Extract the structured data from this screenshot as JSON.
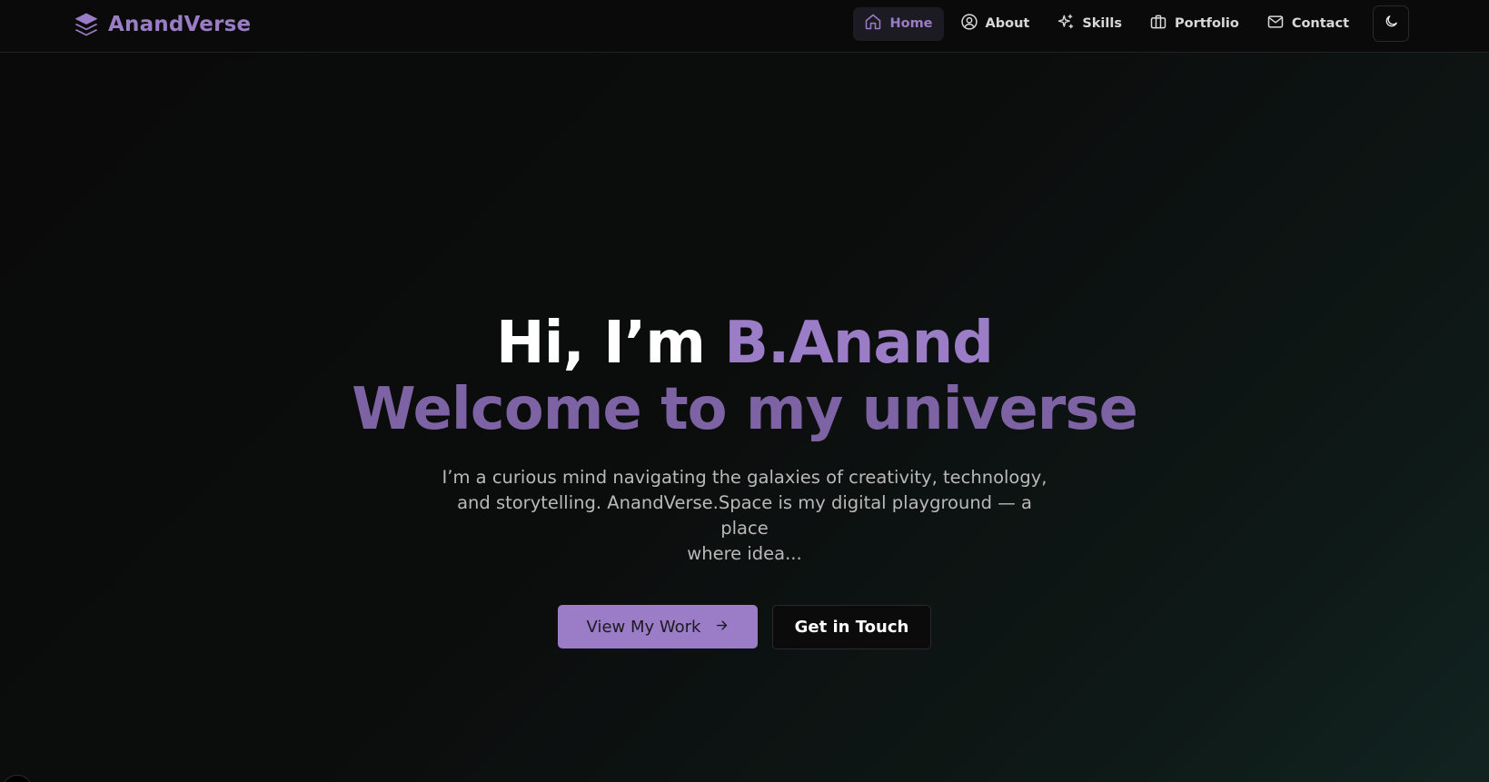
{
  "brand": {
    "name": "AnandVerse",
    "icon": "layers-icon",
    "color": "#9b7cc6"
  },
  "nav": {
    "items": [
      {
        "label": "Home",
        "icon": "home-icon",
        "active": true
      },
      {
        "label": "About",
        "icon": "user-circle-icon",
        "active": false
      },
      {
        "label": "Skills",
        "icon": "sparkles-icon",
        "active": false
      },
      {
        "label": "Portfolio",
        "icon": "briefcase-icon",
        "active": false
      },
      {
        "label": "Contact",
        "icon": "mail-icon",
        "active": false
      }
    ],
    "theme_toggle_icon": "moon-icon"
  },
  "hero": {
    "greeting": "Hi, I’m ",
    "name": "B.Anand",
    "tagline": "Welcome to my universe",
    "description_lines": [
      "I’m a curious mind navigating the galaxies of creativity, technology,",
      "and storytelling. AnandVerse.Space is my digital playground — a place",
      "where idea..."
    ]
  },
  "actions": {
    "primary_label": "View My Work",
    "primary_icon": "arrow-right-icon",
    "secondary_label": "Get in Touch"
  },
  "colors": {
    "accent": "#9b7cc6",
    "accent_dark": "#7d63a3",
    "background": "#0a0a0a"
  }
}
